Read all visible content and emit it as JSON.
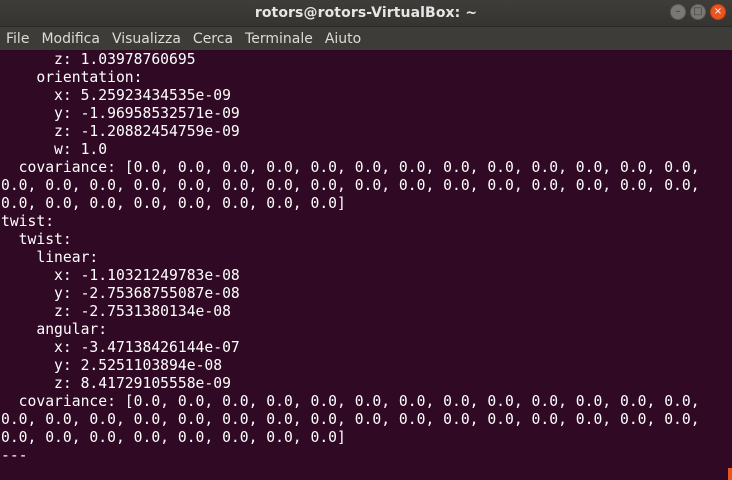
{
  "window": {
    "title": "rotors@rotors-VirtualBox: ~",
    "buttons": {
      "minimize": "–",
      "maximize": "□",
      "close": "×"
    }
  },
  "menu": {
    "items": [
      "File",
      "Modifica",
      "Visualizza",
      "Cerca",
      "Terminale",
      "Aiuto"
    ]
  },
  "colors": {
    "terminal_bg": "#300a24",
    "accent": "#e95420"
  },
  "terminal": {
    "lines": [
      "      z: 1.03978760695",
      "    orientation:",
      "      x: 5.25923434535e-09",
      "      y: -1.96958532571e-09",
      "      z: -1.20882454759e-09",
      "      w: 1.0",
      "  covariance: [0.0, 0.0, 0.0, 0.0, 0.0, 0.0, 0.0, 0.0, 0.0, 0.0, 0.0, 0.0, 0.0,",
      "0.0, 0.0, 0.0, 0.0, 0.0, 0.0, 0.0, 0.0, 0.0, 0.0, 0.0, 0.0, 0.0, 0.0, 0.0, 0.0,",
      "0.0, 0.0, 0.0, 0.0, 0.0, 0.0, 0.0, 0.0]",
      "twist:",
      "  twist:",
      "    linear:",
      "      x: -1.10321249783e-08",
      "      y: -2.75368755087e-08",
      "      z: -2.7531380134e-08",
      "    angular:",
      "      x: -3.47138426144e-07",
      "      y: 2.5251103894e-08",
      "      z: 8.41729105558e-09",
      "  covariance: [0.0, 0.0, 0.0, 0.0, 0.0, 0.0, 0.0, 0.0, 0.0, 0.0, 0.0, 0.0, 0.0,",
      "0.0, 0.0, 0.0, 0.0, 0.0, 0.0, 0.0, 0.0, 0.0, 0.0, 0.0, 0.0, 0.0, 0.0, 0.0, 0.0,",
      "0.0, 0.0, 0.0, 0.0, 0.0, 0.0, 0.0, 0.0]",
      "---"
    ]
  }
}
